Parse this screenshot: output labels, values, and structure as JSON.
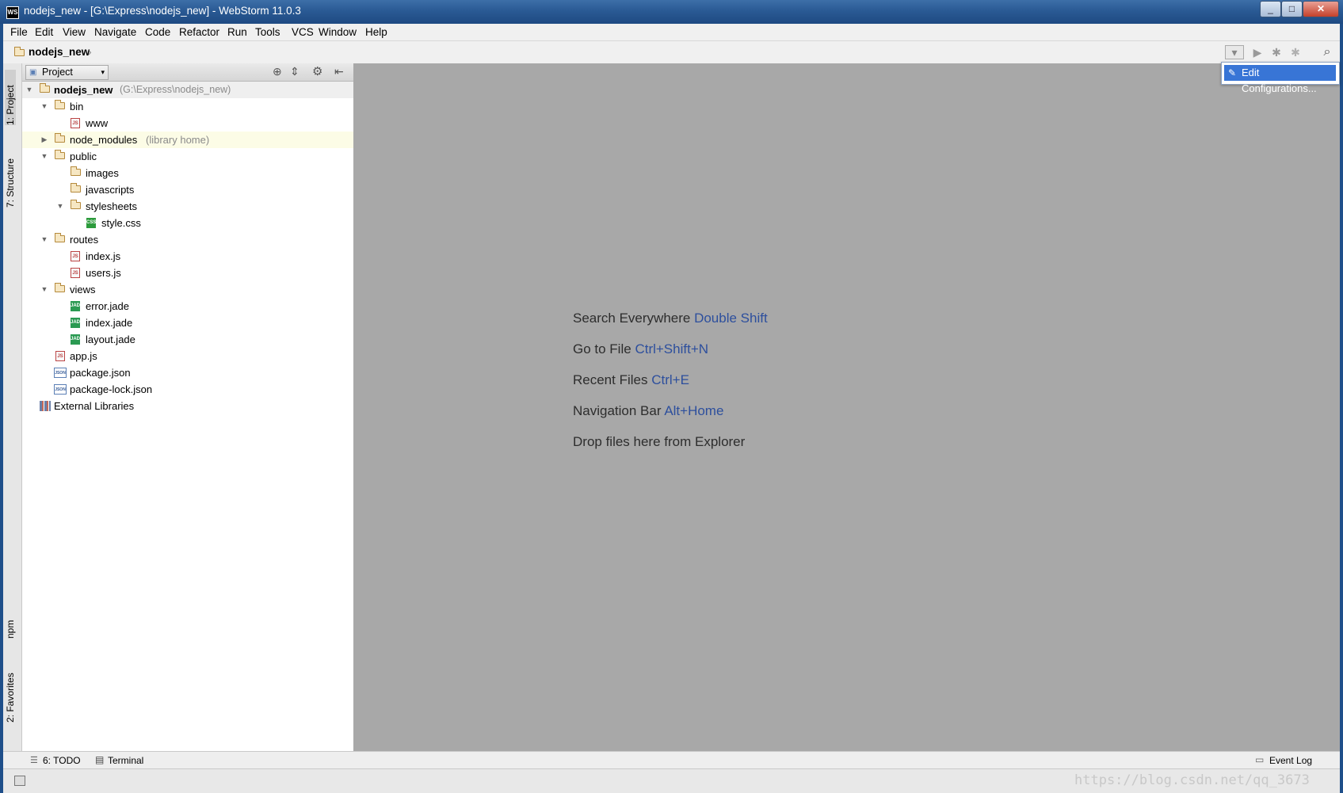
{
  "window": {
    "title": "nodejs_new - [G:\\Express\\nodejs_new] - WebStorm 11.0.3",
    "app_icon": "WS",
    "minimize": "_",
    "maximize": "□",
    "close": "✕"
  },
  "menu": [
    "File",
    "Edit",
    "View",
    "Navigate",
    "Code",
    "Refactor",
    "Run",
    "Tools",
    "VCS",
    "Window",
    "Help"
  ],
  "navbar": {
    "breadcrumb": "nodejs_new",
    "separator": "›"
  },
  "side_tabs": {
    "project": "1: Project",
    "structure": "7: Structure",
    "npm": "npm",
    "favorites": "2: Favorites"
  },
  "project_panel": {
    "view_mode": "Project",
    "tree": [
      {
        "label": "nodejs_new",
        "hint": "(G:\\Express\\nodejs_new)",
        "type": "folder",
        "expanded": true
      },
      {
        "label": "bin",
        "type": "folder",
        "expanded": true
      },
      {
        "label": "www",
        "type": "js"
      },
      {
        "label": "node_modules",
        "hint": "(library home)",
        "type": "folder",
        "expanded": false
      },
      {
        "label": "public",
        "type": "folder",
        "expanded": true
      },
      {
        "label": "images",
        "type": "folder"
      },
      {
        "label": "javascripts",
        "type": "folder"
      },
      {
        "label": "stylesheets",
        "type": "folder",
        "expanded": true
      },
      {
        "label": "style.css",
        "type": "css"
      },
      {
        "label": "routes",
        "type": "folder",
        "expanded": true
      },
      {
        "label": "index.js",
        "type": "js"
      },
      {
        "label": "users.js",
        "type": "js"
      },
      {
        "label": "views",
        "type": "folder",
        "expanded": true
      },
      {
        "label": "error.jade",
        "type": "jade"
      },
      {
        "label": "index.jade",
        "type": "jade"
      },
      {
        "label": "layout.jade",
        "type": "jade"
      },
      {
        "label": "app.js",
        "type": "js"
      },
      {
        "label": "package.json",
        "type": "json"
      },
      {
        "label": "package-lock.json",
        "type": "json"
      },
      {
        "label": "External Libraries",
        "type": "library"
      }
    ]
  },
  "editor_hints": [
    {
      "text": "Search Everywhere",
      "key": "Double Shift"
    },
    {
      "text": "Go to File",
      "key": "Ctrl+Shift+N"
    },
    {
      "text": "Recent Files",
      "key": "Ctrl+E"
    },
    {
      "text": "Navigation Bar",
      "key": "Alt+Home"
    },
    {
      "text": "Drop files here from Explorer",
      "key": ""
    }
  ],
  "run_popup": {
    "item": "Edit Configurations..."
  },
  "bottom_tabs": {
    "todo": "6: TODO",
    "terminal": "Terminal",
    "event_log": "Event Log"
  },
  "watermark": "https://blog.csdn.net/qq_3673",
  "icon_glyphs": {
    "run": "▶",
    "debug": "✱",
    "search": "⌕",
    "dropdown": "▾",
    "expanded": "▼",
    "collapsed": "▶",
    "locate": "⊕",
    "collapse_all": "⇕",
    "gear": "⚙",
    "hide": "⇤"
  },
  "colors": {
    "editor_bg": "#a8a8a8",
    "hint_key": "#2d4f9d",
    "selection": "#3875d6",
    "node_modules_highlight": "#fcfce6"
  }
}
